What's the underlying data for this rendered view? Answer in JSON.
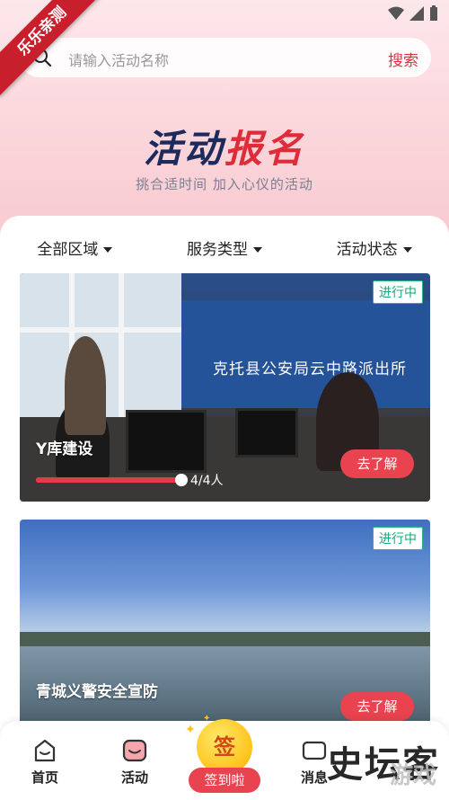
{
  "corner_ribbon": "乐乐亲测",
  "search": {
    "placeholder": "请输入活动名称",
    "button_label": "搜索"
  },
  "banner": {
    "title_part1": "活动",
    "title_part2": "报名",
    "subtitle": "挑合适时间  加入心仪的活动"
  },
  "filters": [
    {
      "label": "全部区域"
    },
    {
      "label": "服务类型"
    },
    {
      "label": "活动状态"
    }
  ],
  "activities": [
    {
      "title": "Y库建设",
      "status": "进行中",
      "progress": 1.0,
      "progress_text": "4/4人",
      "button": "去了解",
      "photo_sign": "克托县公安局云中路派出所"
    },
    {
      "title": "青城义警安全宣防",
      "status": "进行中",
      "button": "去了解"
    }
  ],
  "tabbar": {
    "home": "首页",
    "activity": "活动",
    "checkin_icon": "签",
    "checkin": "签到啦",
    "message": "消息"
  },
  "watermark": {
    "main": "史坛客",
    "sub": "游戏"
  },
  "colors": {
    "accent": "#e8434e",
    "status_green": "#1aa87a",
    "brand_navy": "#1d2a5c"
  }
}
